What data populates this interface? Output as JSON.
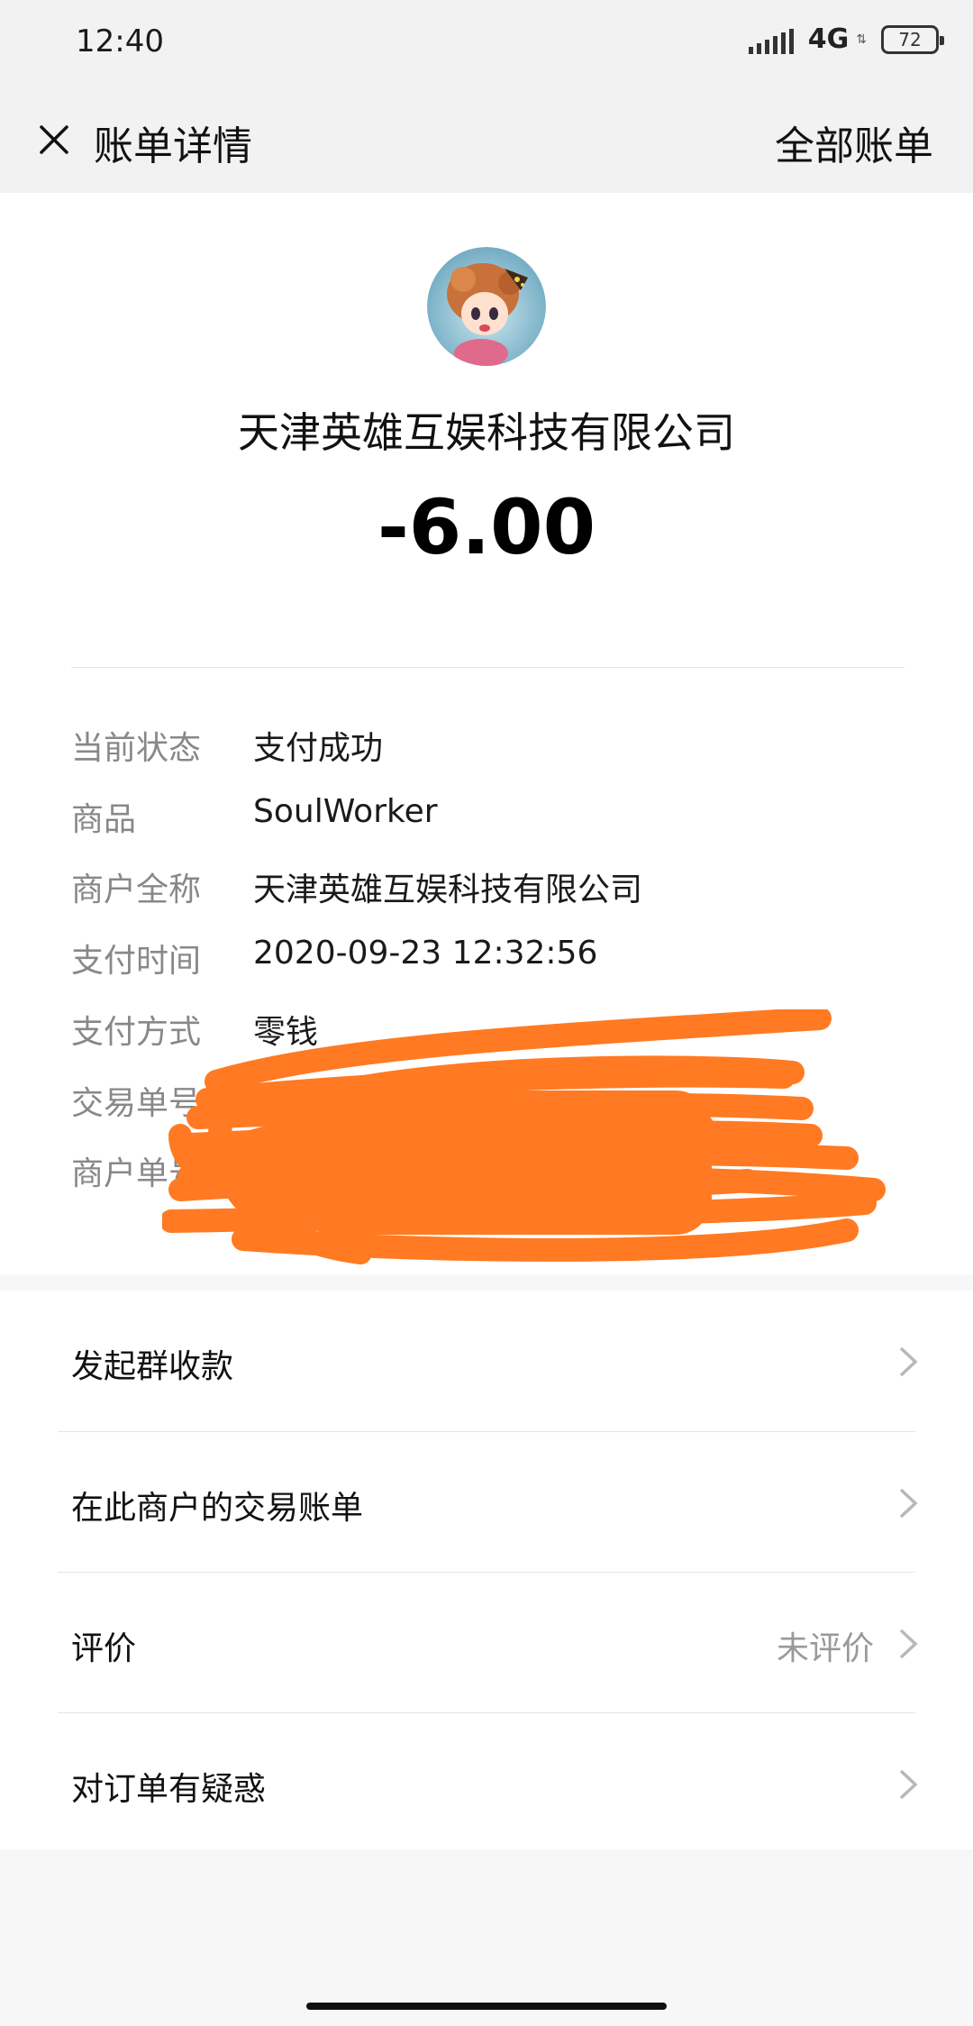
{
  "status_bar": {
    "time": "12:40",
    "network": "4G",
    "battery": "72"
  },
  "header": {
    "title": "账单详情",
    "right_link": "全部账单"
  },
  "merchant": {
    "name": "天津英雄互娱科技有限公司",
    "amount": "-6.00"
  },
  "details": [
    {
      "label": "当前状态",
      "value": "支付成功"
    },
    {
      "label": "商品",
      "value": "SoulWorker"
    },
    {
      "label": "商户全称",
      "value": "天津英雄互娱科技有限公司"
    },
    {
      "label": "支付时间",
      "value": "2020-09-23 12:32:56"
    },
    {
      "label": "支付方式",
      "value": "零钱"
    },
    {
      "label": "交易单号",
      "value": ""
    },
    {
      "label": "商户单号",
      "value": ""
    }
  ],
  "menu": [
    {
      "label": "发起群收款",
      "value": ""
    },
    {
      "label": "在此商户的交易账单",
      "value": ""
    },
    {
      "label": "评价",
      "value": "未评价"
    },
    {
      "label": "对订单有疑惑",
      "value": ""
    }
  ],
  "colors": {
    "redaction": "#ff7a22",
    "label_gray": "#888888"
  }
}
